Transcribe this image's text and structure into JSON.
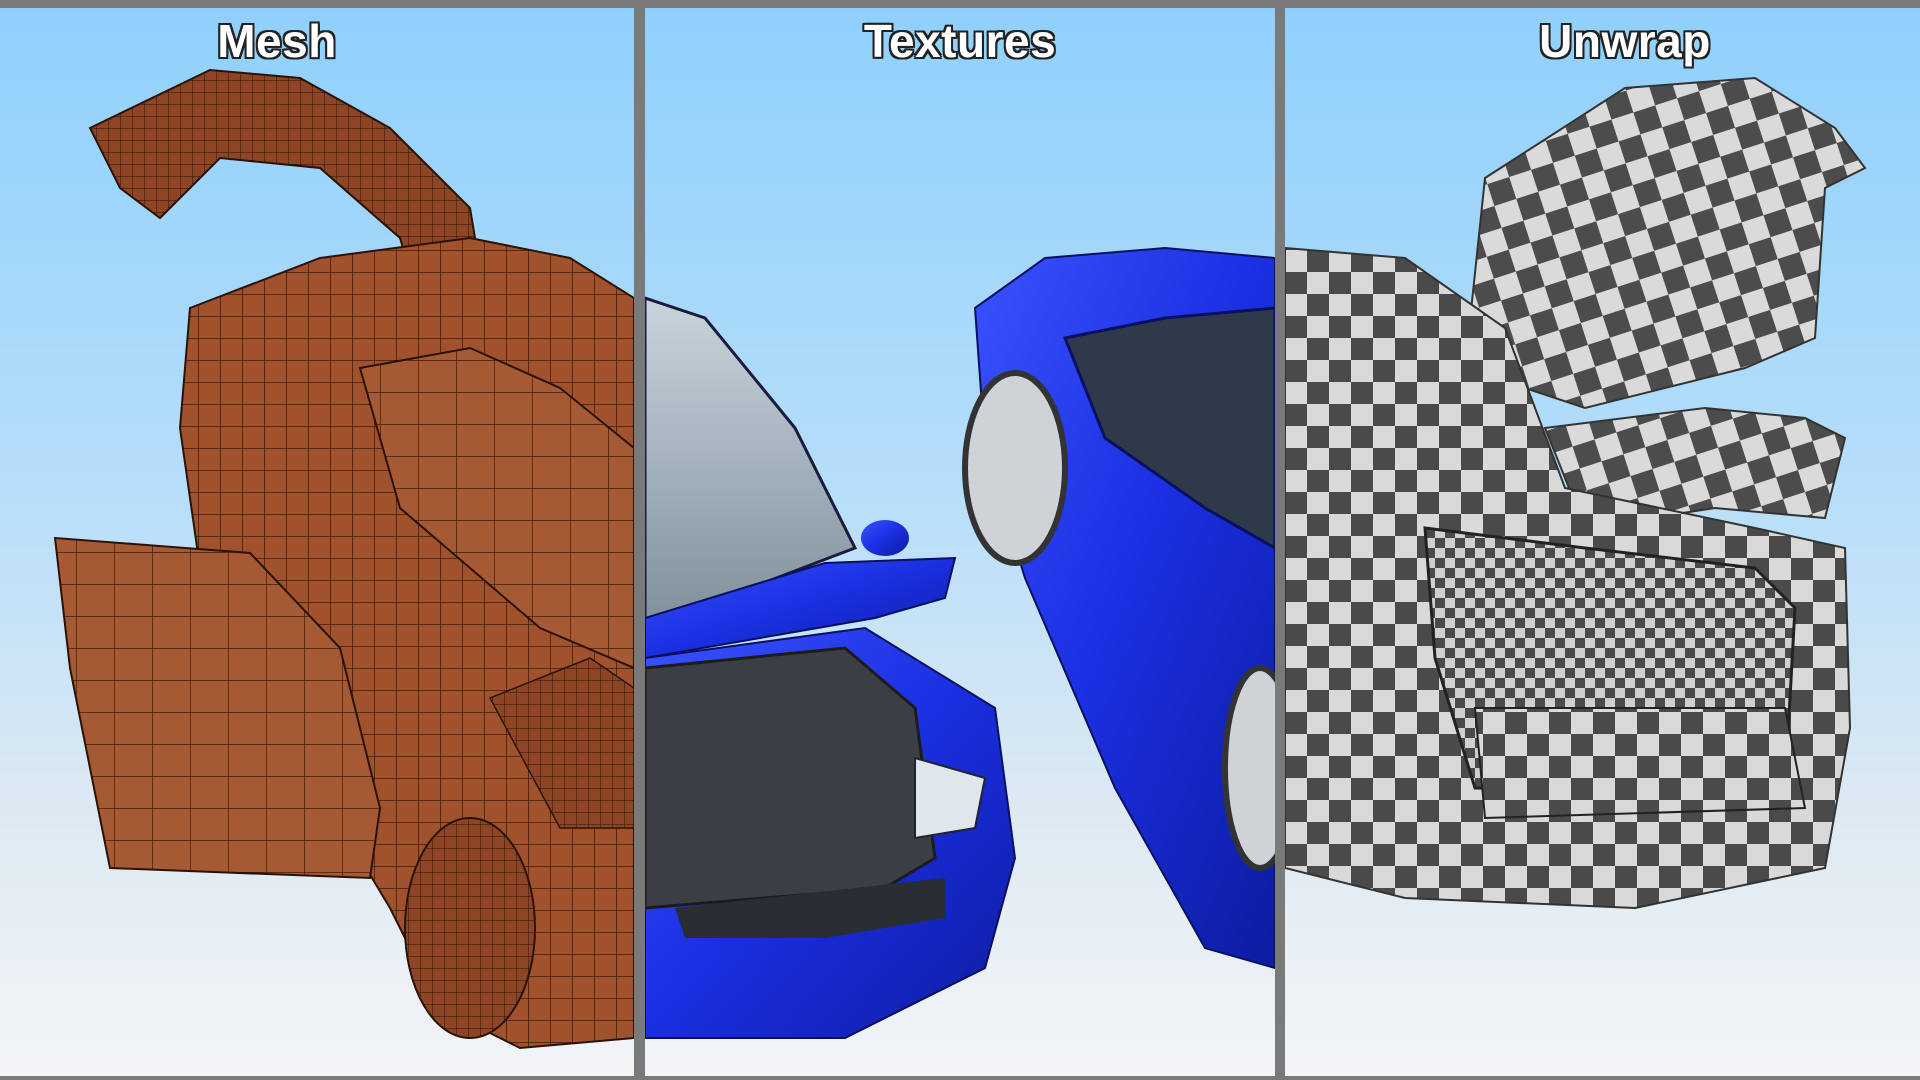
{
  "panels": [
    {
      "title": "Mesh"
    },
    {
      "title": "Textures"
    },
    {
      "title": "Unwrap"
    }
  ],
  "colors": {
    "mesh_fill": "#a0522d",
    "mesh_lines": "#2b1208",
    "car_paint": "#1a2fe0",
    "checker_dark": "#4a4a4a",
    "checker_light": "#d9d9d9",
    "sky_top": "#8fd0fb",
    "sky_bottom": "#f3f5f7",
    "divider": "#7a7a7a"
  }
}
